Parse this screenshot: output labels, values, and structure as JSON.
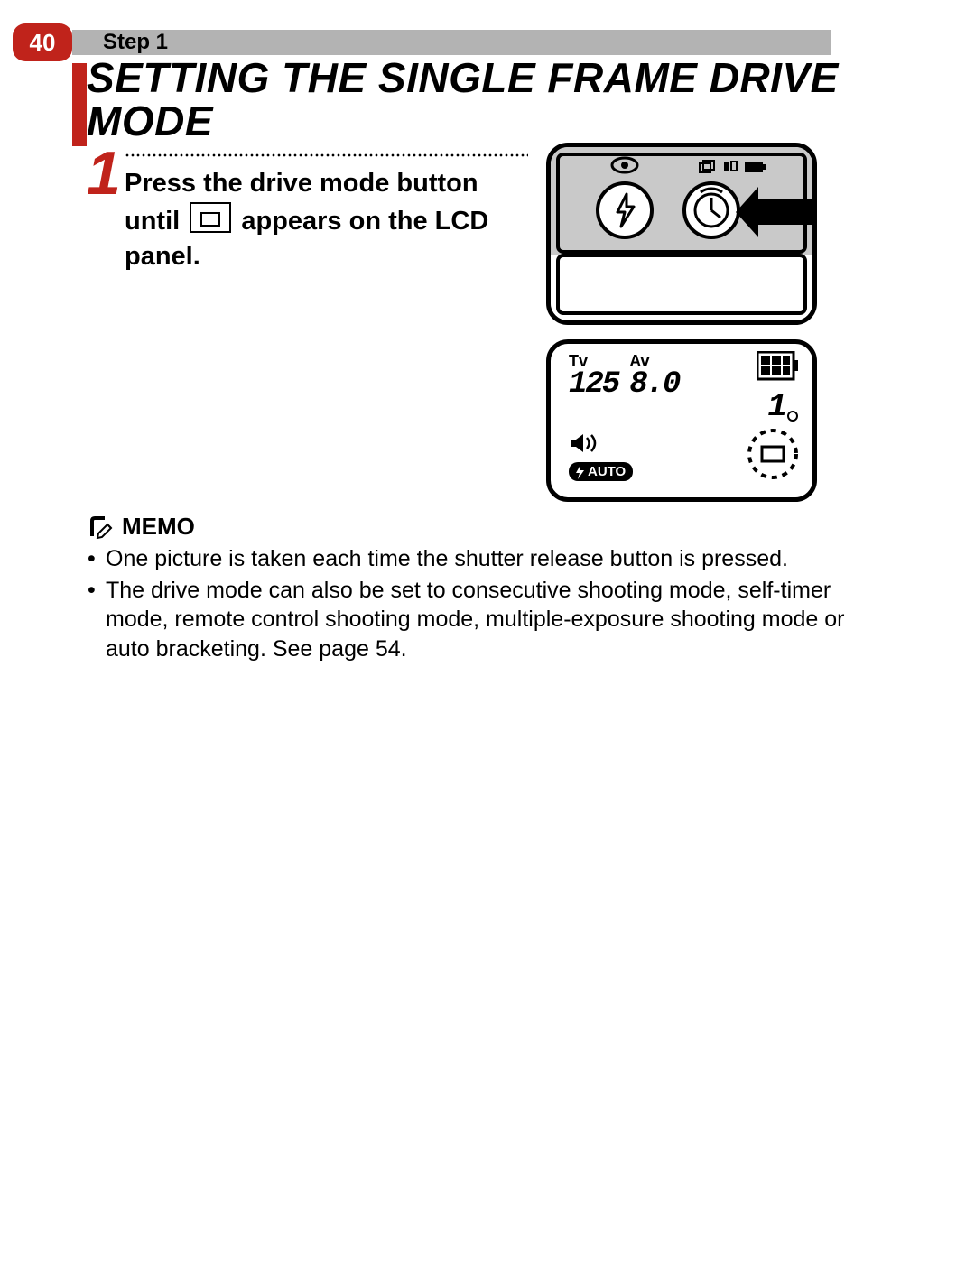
{
  "page_number": "40",
  "step_label": "Step 1",
  "title": "SETTING THE SINGLE FRAME DRIVE MODE",
  "step_digit": "1",
  "instruction_part1": "Press the drive mode button until ",
  "instruction_part2": " appears on the LCD panel.",
  "lcd": {
    "tv_label": "Tv",
    "tv_value": "125",
    "av_label": "Av",
    "av_value": "8.0",
    "count": "1",
    "auto_label": "AUTO"
  },
  "memo_heading": "MEMO",
  "memo_items": [
    "One picture is taken each time the shutter release button is pressed.",
    "The drive mode can also be set to consecutive shooting mode, self-timer mode, remote control shooting mode, multiple-exposure shooting mode or auto bracketing. See page 54."
  ]
}
